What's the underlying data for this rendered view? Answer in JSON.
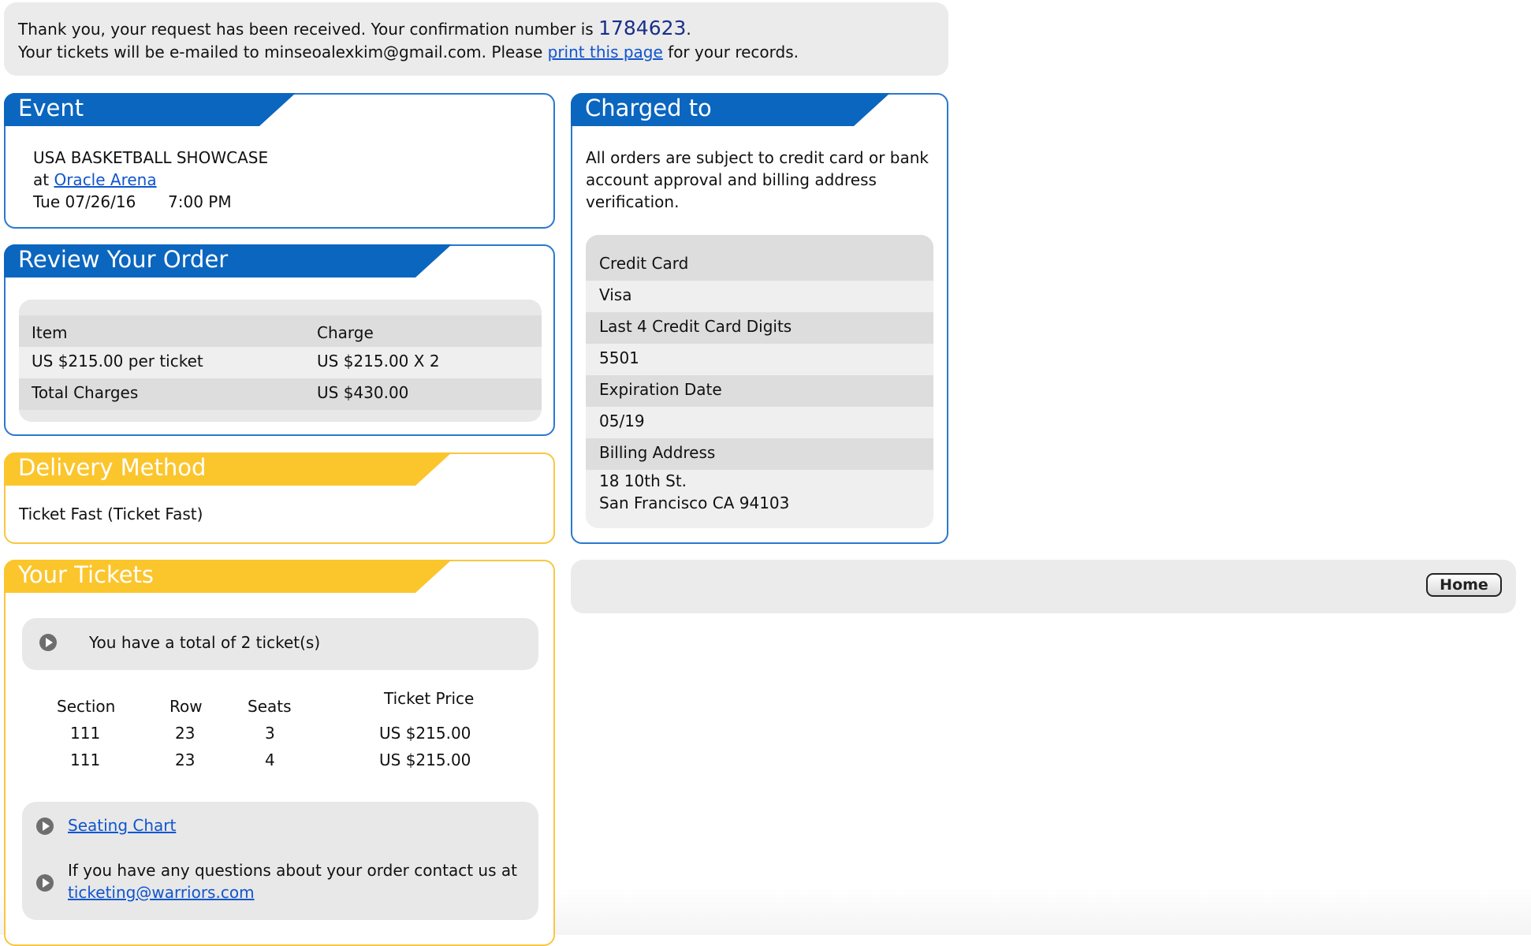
{
  "confirmation": {
    "line1_prefix": "Thank you, your request has been received. Your confirmation number is ",
    "number": "1784623",
    "line1_suffix": ".",
    "line2_prefix": "Your tickets will be e-mailed to minseoalexkim@gmail.com. Please ",
    "print_link": "print this page",
    "line2_suffix": " for your records."
  },
  "event": {
    "title": "Event",
    "name": "USA BASKETBALL SHOWCASE",
    "at_label": "at ",
    "venue_link": "Oracle Arena",
    "date": "Tue 07/26/16",
    "time": "7:00 PM"
  },
  "review": {
    "title": "Review Your Order",
    "headers": {
      "item": "Item",
      "charge": "Charge"
    },
    "rows": [
      {
        "item": "US  $215.00 per ticket",
        "charge": "US  $215.00 X 2"
      },
      {
        "item": "Total Charges",
        "charge": "US  $430.00"
      }
    ]
  },
  "delivery": {
    "title": "Delivery Method",
    "method": "Ticket Fast (Ticket Fast)"
  },
  "tickets": {
    "title": "Your Tickets",
    "total_text": "You have a total of 2 ticket(s)",
    "headers": {
      "section": "Section",
      "row": "Row",
      "seats": "Seats",
      "price": "Ticket Price"
    },
    "rows": [
      {
        "section": "111",
        "row": "23",
        "seat": "3",
        "price": "US  $215.00"
      },
      {
        "section": "111",
        "row": "23",
        "seat": "4",
        "price": "US  $215.00"
      }
    ],
    "seating_chart_link": "Seating Chart",
    "questions_text": "If you have any questions about your order contact us at",
    "email_link": "ticketing@warriors.com"
  },
  "charged": {
    "title": "Charged to",
    "notice_line1": "All orders are subject to credit card or bank",
    "notice_line2": "account approval and billing address",
    "notice_line3": "verification.",
    "fields": {
      "card_label": "Credit Card",
      "card_value": "Visa",
      "last4_label": "Last 4 Credit Card Digits",
      "last4_value": "5501",
      "exp_label": "Expiration Date",
      "exp_value": "05/19",
      "billing_label": "Billing Address",
      "billing_line1": "18 10th St.",
      "billing_line2": "San Francisco CA 94103"
    }
  },
  "home_button": "Home",
  "colors": {
    "blue_header": "#0b66bf",
    "yellow_header": "#fbc52c",
    "link": "#1155cc"
  }
}
